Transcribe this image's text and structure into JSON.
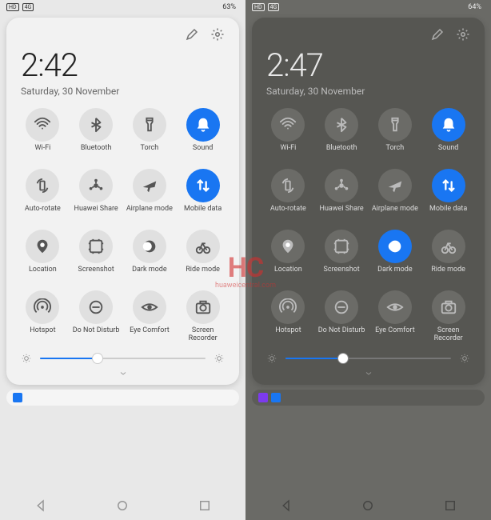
{
  "watermark": {
    "main": "HC",
    "sub": "huaweicentral.com"
  },
  "phones": [
    {
      "theme": "light",
      "status": {
        "left_badges": [
          "HD",
          "4G"
        ],
        "battery_pct": "63%"
      },
      "time": "2:42",
      "date": "Saturday, 30 November",
      "brightness_pct": 35,
      "tiles": [
        {
          "id": "wifi",
          "label": "Wi-Fi",
          "on": false,
          "icon": "wifi"
        },
        {
          "id": "bluetooth",
          "label": "Bluetooth",
          "on": false,
          "icon": "bluetooth"
        },
        {
          "id": "torch",
          "label": "Torch",
          "on": false,
          "icon": "torch"
        },
        {
          "id": "sound",
          "label": "Sound",
          "on": true,
          "icon": "bell"
        },
        {
          "id": "autorotate",
          "label": "Auto-rotate",
          "on": false,
          "icon": "rotate"
        },
        {
          "id": "huaweishare",
          "label": "Huawei Share",
          "on": false,
          "icon": "share"
        },
        {
          "id": "airplane",
          "label": "Airplane mode",
          "on": false,
          "icon": "plane"
        },
        {
          "id": "mobiledata",
          "label": "Mobile data",
          "on": true,
          "icon": "data"
        },
        {
          "id": "location",
          "label": "Location",
          "on": false,
          "icon": "pin"
        },
        {
          "id": "screenshot",
          "label": "Screenshot",
          "on": false,
          "icon": "screenshot"
        },
        {
          "id": "darkmode",
          "label": "Dark mode",
          "on": false,
          "icon": "darkmode"
        },
        {
          "id": "ridemode",
          "label": "Ride mode",
          "on": false,
          "icon": "ride"
        },
        {
          "id": "hotspot",
          "label": "Hotspot",
          "on": false,
          "icon": "hotspot"
        },
        {
          "id": "dnd",
          "label": "Do Not Disturb",
          "on": false,
          "icon": "dnd"
        },
        {
          "id": "eyecomfort",
          "label": "Eye Comfort",
          "on": false,
          "icon": "eye"
        },
        {
          "id": "recorder",
          "label": "Screen Recorder",
          "on": false,
          "icon": "camera"
        }
      ],
      "notif_icons": [
        "#1976f2"
      ]
    },
    {
      "theme": "dark",
      "status": {
        "left_badges": [
          "HD",
          "4G"
        ],
        "battery_pct": "64%"
      },
      "time": "2:47",
      "date": "Saturday, 30 November",
      "brightness_pct": 35,
      "tiles": [
        {
          "id": "wifi",
          "label": "Wi-Fi",
          "on": false,
          "icon": "wifi"
        },
        {
          "id": "bluetooth",
          "label": "Bluetooth",
          "on": false,
          "icon": "bluetooth"
        },
        {
          "id": "torch",
          "label": "Torch",
          "on": false,
          "icon": "torch"
        },
        {
          "id": "sound",
          "label": "Sound",
          "on": true,
          "icon": "bell"
        },
        {
          "id": "autorotate",
          "label": "Auto-rotate",
          "on": false,
          "icon": "rotate"
        },
        {
          "id": "huaweishare",
          "label": "Huawei Share",
          "on": false,
          "icon": "share"
        },
        {
          "id": "airplane",
          "label": "Airplane mode",
          "on": false,
          "icon": "plane"
        },
        {
          "id": "mobiledata",
          "label": "Mobile data",
          "on": true,
          "icon": "data"
        },
        {
          "id": "location",
          "label": "Location",
          "on": false,
          "icon": "pin"
        },
        {
          "id": "screenshot",
          "label": "Screenshot",
          "on": false,
          "icon": "screenshot"
        },
        {
          "id": "darkmode",
          "label": "Dark mode",
          "on": true,
          "icon": "darkmode"
        },
        {
          "id": "ridemode",
          "label": "Ride mode",
          "on": false,
          "icon": "ride"
        },
        {
          "id": "hotspot",
          "label": "Hotspot",
          "on": false,
          "icon": "hotspot"
        },
        {
          "id": "dnd",
          "label": "Do Not Disturb",
          "on": false,
          "icon": "dnd"
        },
        {
          "id": "eyecomfort",
          "label": "Eye Comfort",
          "on": false,
          "icon": "eye"
        },
        {
          "id": "recorder",
          "label": "Screen Recorder",
          "on": false,
          "icon": "camera"
        }
      ],
      "notif_icons": [
        "#7c3aed",
        "#1976f2"
      ]
    }
  ]
}
